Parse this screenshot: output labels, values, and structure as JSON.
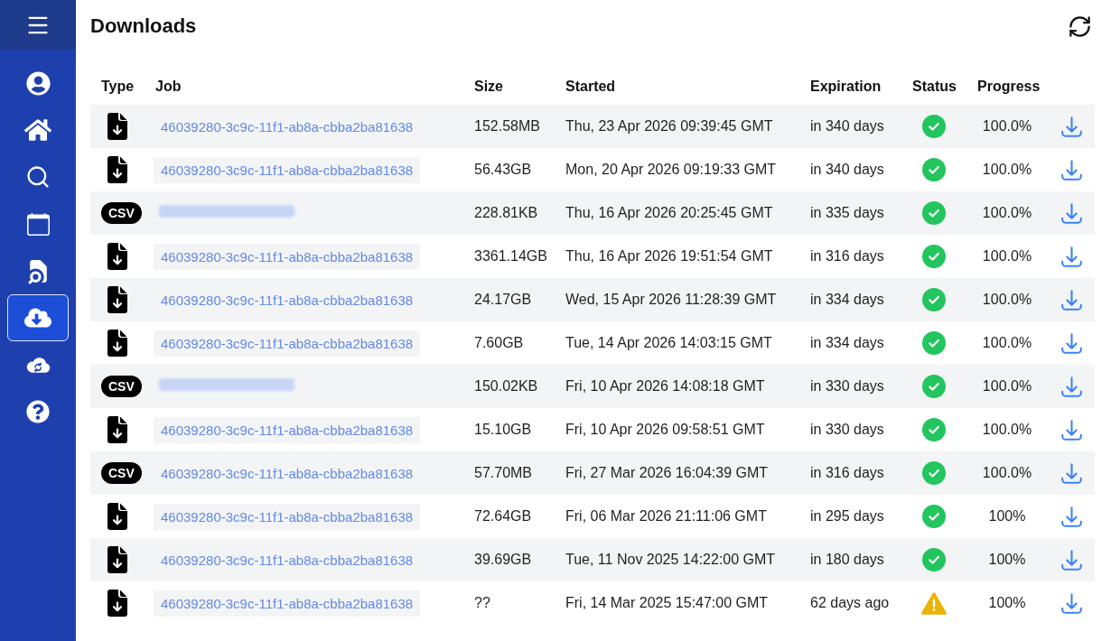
{
  "sidebar": {
    "items": [
      {
        "selected": false
      },
      {
        "selected": false
      },
      {
        "selected": false
      },
      {
        "selected": false
      },
      {
        "selected": false
      },
      {
        "selected": true
      },
      {
        "selected": false
      },
      {
        "selected": false
      }
    ]
  },
  "page": {
    "title": "Downloads"
  },
  "table": {
    "columns": [
      "Type",
      "Job",
      "Size",
      "Started",
      "Expiration",
      "Status",
      "Progress"
    ],
    "rows": [
      {
        "type": {
          "kind": "file"
        },
        "job": {
          "kind": "link",
          "text": "46039280-3c9c-11f1-ab8a-cbba2ba81638"
        },
        "size": "152.58MB",
        "started": "Thu, 23 Apr 2026 09:39:45 GMT",
        "expiration": "in 340 days",
        "status": {
          "kind": "ok"
        },
        "progress": "100.0%"
      },
      {
        "type": {
          "kind": "file"
        },
        "job": {
          "kind": "link",
          "text": "46039280-3c9c-11f1-ab8a-cbba2ba81638"
        },
        "size": "56.43GB",
        "started": "Mon, 20 Apr 2026 09:19:33 GMT",
        "expiration": "in 340 days",
        "status": {
          "kind": "ok"
        },
        "progress": "100.0%"
      },
      {
        "type": {
          "kind": "csv",
          "label": "CSV"
        },
        "job": {
          "kind": "redacted"
        },
        "size": "228.81KB",
        "started": "Thu, 16 Apr 2026 20:25:45 GMT",
        "expiration": "in 335 days",
        "status": {
          "kind": "ok"
        },
        "progress": "100.0%"
      },
      {
        "type": {
          "kind": "file"
        },
        "job": {
          "kind": "link",
          "text": "46039280-3c9c-11f1-ab8a-cbba2ba81638"
        },
        "size": "3361.14GB",
        "started": "Thu, 16 Apr 2026 19:51:54 GMT",
        "expiration": "in 316 days",
        "status": {
          "kind": "ok"
        },
        "progress": "100.0%"
      },
      {
        "type": {
          "kind": "file"
        },
        "job": {
          "kind": "link",
          "text": "46039280-3c9c-11f1-ab8a-cbba2ba81638"
        },
        "size": "24.17GB",
        "started": "Wed, 15 Apr 2026 11:28:39 GMT",
        "expiration": "in 334 days",
        "status": {
          "kind": "ok"
        },
        "progress": "100.0%"
      },
      {
        "type": {
          "kind": "file"
        },
        "job": {
          "kind": "link",
          "text": "46039280-3c9c-11f1-ab8a-cbba2ba81638"
        },
        "size": "7.60GB",
        "started": "Tue, 14 Apr 2026 14:03:15 GMT",
        "expiration": "in 334 days",
        "status": {
          "kind": "ok"
        },
        "progress": "100.0%"
      },
      {
        "type": {
          "kind": "csv",
          "label": "CSV"
        },
        "job": {
          "kind": "redacted"
        },
        "size": "150.02KB",
        "started": "Fri, 10 Apr 2026 14:08:18 GMT",
        "expiration": "in 330 days",
        "status": {
          "kind": "ok"
        },
        "progress": "100.0%"
      },
      {
        "type": {
          "kind": "file"
        },
        "job": {
          "kind": "link",
          "text": "46039280-3c9c-11f1-ab8a-cbba2ba81638"
        },
        "size": "15.10GB",
        "started": "Fri, 10 Apr 2026 09:58:51 GMT",
        "expiration": "in 330 days",
        "status": {
          "kind": "ok"
        },
        "progress": "100.0%"
      },
      {
        "type": {
          "kind": "csv",
          "label": "CSV"
        },
        "job": {
          "kind": "link",
          "text": "46039280-3c9c-11f1-ab8a-cbba2ba81638"
        },
        "size": "57.70MB",
        "started": "Fri, 27 Mar 2026 16:04:39 GMT",
        "expiration": "in 316 days",
        "status": {
          "kind": "ok"
        },
        "progress": "100.0%"
      },
      {
        "type": {
          "kind": "file"
        },
        "job": {
          "kind": "link",
          "text": "46039280-3c9c-11f1-ab8a-cbba2ba81638"
        },
        "size": "72.64GB",
        "started": "Fri, 06 Mar 2026 21:11:06 GMT",
        "expiration": "in 295 days",
        "status": {
          "kind": "ok"
        },
        "progress": "100%"
      },
      {
        "type": {
          "kind": "file"
        },
        "job": {
          "kind": "link",
          "text": "46039280-3c9c-11f1-ab8a-cbba2ba81638"
        },
        "size": "39.69GB",
        "started": "Tue, 11 Nov 2025 14:22:00 GMT",
        "expiration": "in 180 days",
        "status": {
          "kind": "ok"
        },
        "progress": "100%"
      },
      {
        "type": {
          "kind": "file"
        },
        "job": {
          "kind": "link",
          "text": "46039280-3c9c-11f1-ab8a-cbba2ba81638"
        },
        "size": "??",
        "started": "Fri, 14 Mar 2025 15:47:00 GMT",
        "expiration": "62 days ago",
        "status": {
          "kind": "warning"
        },
        "progress": "100%"
      }
    ]
  }
}
